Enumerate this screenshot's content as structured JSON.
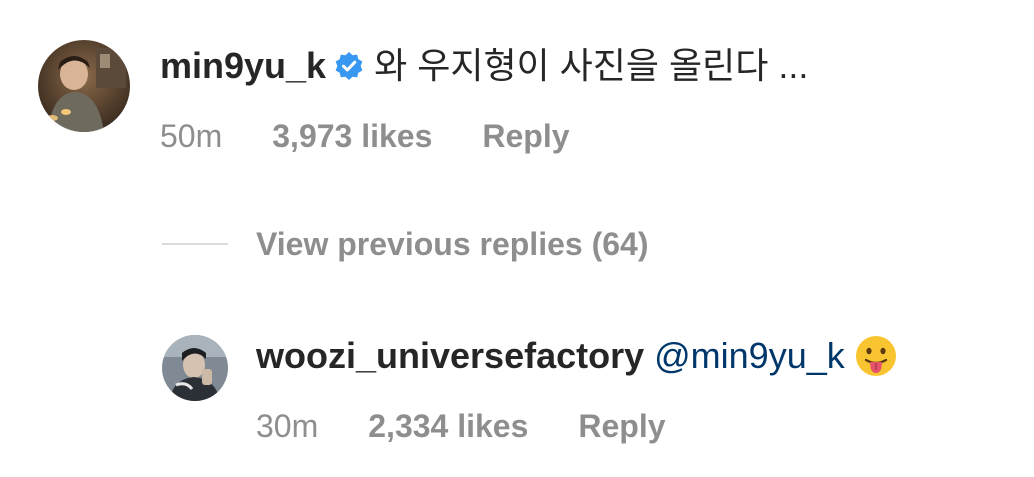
{
  "comments": [
    {
      "username": "min9yu_k",
      "verified": true,
      "text": "와 우지형이 사진을 올린다 ...",
      "time": "50m",
      "likes": "3,973 likes",
      "reply_label": "Reply"
    }
  ],
  "view_replies": {
    "label": "View previous replies (64)"
  },
  "reply": {
    "username": "woozi_universefactory",
    "mention": "@min9yu_k",
    "emoji": "face-with-tongue",
    "time": "30m",
    "likes": "2,334 likes",
    "reply_label": "Reply"
  },
  "colors": {
    "text": "#262626",
    "secondary": "#8e8e8e",
    "mention": "#00376b",
    "verified": "#3897f0",
    "divider": "#dbdbdb"
  },
  "icons": {
    "verified": "verified-badge-icon",
    "emoji": "tongue-emoji-icon"
  }
}
